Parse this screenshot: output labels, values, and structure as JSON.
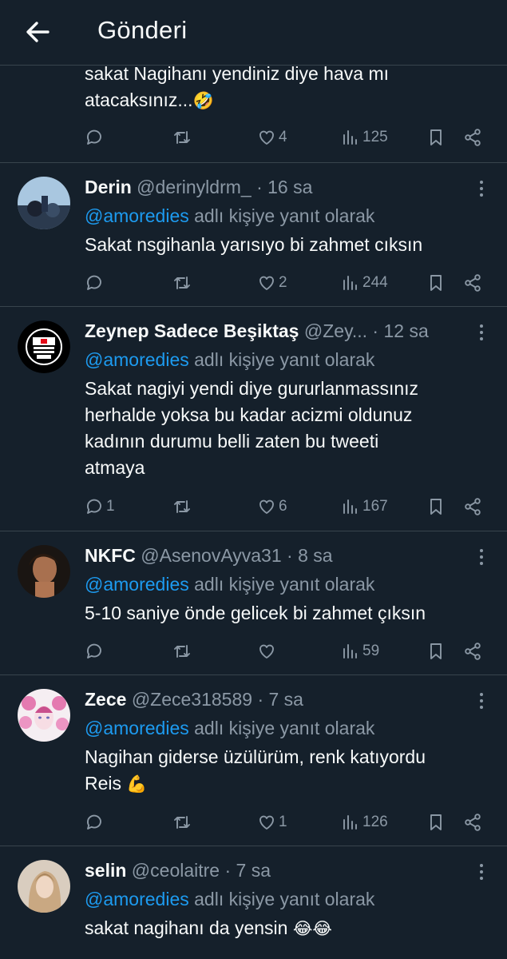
{
  "header": {
    "title": "Gönderi"
  },
  "continued": {
    "text_lines": [
      "sakat Nagihanı yendiniz diye hava mı",
      "atacaksınız..."
    ],
    "emoji": "🤣",
    "likes": "4",
    "views": "125"
  },
  "reply_prefix": "@amoredies",
  "reply_suffix": " adlı kişiye yanıt olarak",
  "tweets": [
    {
      "name": "Derin",
      "handle": " @derinyldrm_ · 16 sa",
      "lines": [
        "Sakat nsgihanla yarısıyo bi zahmet cıksın"
      ],
      "emoji": "",
      "replies": "",
      "likes": "2",
      "views": "244"
    },
    {
      "name": "Zeynep Sadece Beşiktaş",
      "handle": " @Zey... · 12 sa",
      "lines": [
        "Sakat nagiyi yendi diye gururlanmassınız",
        "herhalde yoksa bu kadar acizmi oldunuz",
        "kadının durumu belli zaten bu tweeti",
        "atmaya"
      ],
      "emoji": "",
      "replies": "1",
      "likes": "6",
      "views": "167"
    },
    {
      "name": "NKFC",
      "handle": " @AsenovAyva31 · 8 sa",
      "lines": [
        "5-10 saniye önde gelicek bi zahmet çıksın"
      ],
      "emoji": "",
      "replies": "",
      "likes": "",
      "views": "59"
    },
    {
      "name": "Zece",
      "handle": " @Zece318589 · 7 sa",
      "lines": [
        "Nagihan giderse üzülürüm, renk katıyordu",
        "Reis "
      ],
      "emoji": "💪",
      "replies": "",
      "likes": "1",
      "views": "126"
    },
    {
      "name": "selin",
      "handle": " @ceolaitre · 7 sa",
      "lines": [
        "sakat nagihanı da yensin "
      ],
      "emoji": "😂😂",
      "replies": "",
      "likes": "",
      "views": ""
    }
  ],
  "colors": {
    "background": "#15202b",
    "divider": "#38444d",
    "text": "#f7f9f9",
    "muted": "#8b98a5",
    "accent": "#1d9bf0"
  }
}
